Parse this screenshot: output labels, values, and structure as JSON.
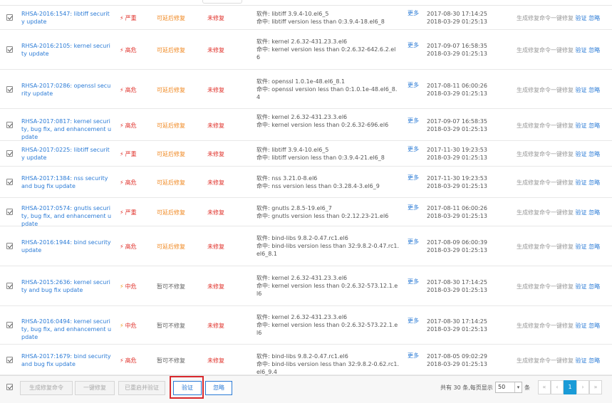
{
  "rows": [
    {
      "name": "RHSA-2016:1547: libtiff security update",
      "level": "严重",
      "level_class": "c-severe",
      "urgency": "可延后修复",
      "urgency_class": "delay",
      "status": "未修复",
      "software": "软件: libtiff 3.9.4-10.el6_5",
      "hit": "命中: libtiff version less than 0:3.9.4-18.el6_8",
      "more": "更多",
      "time1": "2017-08-30 17:14:25",
      "time2": "2018-03-29 01:25:13",
      "gen": "生成修复命令",
      "fix": "一键修复",
      "verify": "验证",
      "ignore": "忽略"
    },
    {
      "name": "RHSA-2016:2105: kernel security update",
      "level": "高危",
      "level_class": "c-high",
      "urgency": "可延后修复",
      "urgency_class": "delay",
      "status": "未修复",
      "software": "软件: kernel 2.6.32-431.23.3.el6",
      "hit": "命中: kernel version less than 0:2.6.32-642.6.2.el6",
      "more": "更多",
      "time1": "2017-09-07 16:58:35",
      "time2": "2018-03-29 01:25:13",
      "gen": "生成修复命令",
      "fix": "一键修复",
      "verify": "验证",
      "ignore": "忽略"
    },
    {
      "name": "RHSA-2017:0286: openssl security update",
      "level": "高危",
      "level_class": "c-high",
      "urgency": "可延后修复",
      "urgency_class": "delay",
      "status": "未修复",
      "software": "软件: openssl 1.0.1e-48.el6_8.1",
      "hit": "命中: openssl version less than 0:1.0.1e-48.el6_8.4",
      "more": "更多",
      "time1": "2017-08-11 06:00:26",
      "time2": "2018-03-29 01:25:13",
      "gen": "生成修复命令",
      "fix": "一键修复",
      "verify": "验证",
      "ignore": "忽略"
    },
    {
      "name": "RHSA-2017:0817: kernel security, bug fix, and enhancement update",
      "level": "高危",
      "level_class": "c-high",
      "urgency": "可延后修复",
      "urgency_class": "delay",
      "status": "未修复",
      "software": "软件: kernel 2.6.32-431.23.3.el6",
      "hit": "命中: kernel version less than 0:2.6.32-696.el6",
      "more": "更多",
      "time1": "2017-09-07 16:58:35",
      "time2": "2018-03-29 01:25:13",
      "gen": "生成修复命令",
      "fix": "一键修复",
      "verify": "验证",
      "ignore": "忽略"
    },
    {
      "name": "RHSA-2017:0225: libtiff security update",
      "level": "严重",
      "level_class": "c-severe",
      "urgency": "可延后修复",
      "urgency_class": "delay",
      "status": "未修复",
      "software": "软件: libtiff 3.9.4-10.el6_5",
      "hit": "命中: libtiff version less than 0:3.9.4-21.el6_8",
      "more": "更多",
      "time1": "2017-11-30 19:23:53",
      "time2": "2018-03-29 01:25:13",
      "gen": "生成修复命令",
      "fix": "一键修复",
      "verify": "验证",
      "ignore": "忽略"
    },
    {
      "name": "RHSA-2017:1384: nss security and bug fix update",
      "level": "高危",
      "level_class": "c-high",
      "urgency": "可延后修复",
      "urgency_class": "delay",
      "status": "未修复",
      "software": "软件: nss 3.21.0-8.el6",
      "hit": "命中: nss version less than 0:3.28.4-3.el6_9",
      "more": "更多",
      "time1": "2017-11-30 19:23:53",
      "time2": "2018-03-29 01:25:13",
      "gen": "生成修复命令",
      "fix": "一键修复",
      "verify": "验证",
      "ignore": "忽略"
    },
    {
      "name": "RHSA-2017:0574: gnutls security, bug fix, and enhancement update",
      "level": "严重",
      "level_class": "c-severe",
      "urgency": "可延后修复",
      "urgency_class": "delay",
      "status": "未修复",
      "software": "软件: gnutls 2.8.5-19.el6_7",
      "hit": "命中: gnutls version less than 0:2.12.23-21.el6",
      "more": "更多",
      "time1": "2017-08-11 06:00:26",
      "time2": "2018-03-29 01:25:13",
      "gen": "生成修复命令",
      "fix": "一键修复",
      "verify": "验证",
      "ignore": "忽略"
    },
    {
      "name": "RHSA-2016:1944: bind security update",
      "level": "高危",
      "level_class": "c-high",
      "urgency": "可延后修复",
      "urgency_class": "delay",
      "status": "未修复",
      "software": "软件: bind-libs 9.8.2-0.47.rc1.el6",
      "hit": "命中: bind-libs version less than 32:9.8.2-0.47.rc1.el6_8.1",
      "more": "更多",
      "time1": "2017-08-09 06:00:39",
      "time2": "2018-03-29 01:25:13",
      "gen": "生成修复命令",
      "fix": "一键修复",
      "verify": "验证",
      "ignore": "忽略"
    },
    {
      "name": "RHSA-2015:2636: kernel security and bug fix update",
      "level": "中危",
      "level_class": "c-mid",
      "urgency": "暂可不修复",
      "urgency_class": "hold",
      "status": "未修复",
      "software": "软件: kernel 2.6.32-431.23.3.el6",
      "hit": "命中: kernel version less than 0:2.6.32-573.12.1.el6",
      "more": "更多",
      "time1": "2017-08-30 17:14:25",
      "time2": "2018-03-29 01:25:13",
      "gen": "生成修复命令",
      "fix": "一键修复",
      "verify": "验证",
      "ignore": "忽略"
    },
    {
      "name": "RHSA-2016:0494: kernel security, bug fix, and enhancement update",
      "level": "中危",
      "level_class": "c-mid",
      "urgency": "暂可不修复",
      "urgency_class": "hold",
      "status": "未修复",
      "software": "软件: kernel 2.6.32-431.23.3.el6",
      "hit": "命中: kernel version less than 0:2.6.32-573.22.1.el6",
      "more": "更多",
      "time1": "2017-08-30 17:14:25",
      "time2": "2018-03-29 01:25:13",
      "gen": "生成修复命令",
      "fix": "一键修复",
      "verify": "验证",
      "ignore": "忽略"
    },
    {
      "name": "RHSA-2017:1679: bind security and bug fix update",
      "level": "高危",
      "level_class": "c-high",
      "urgency": "暂可不修复",
      "urgency_class": "hold",
      "status": "未修复",
      "software": "软件: bind-libs 9.8.2-0.47.rc1.el6",
      "hit": "命中: bind-libs version less than 32:9.8.2-0.62.rc1.el6_9.4",
      "more": "更多",
      "time1": "2017-08-05 09:02:29",
      "time2": "2018-03-29 01:25:13",
      "gen": "生成修复命令",
      "fix": "一键修复",
      "verify": "验证",
      "ignore": "忽略"
    }
  ],
  "footer": {
    "gen_label": "生成修复命令",
    "fix_label": "一键修复",
    "restart_verify_label": "已重启并验证",
    "verify_label": "验证",
    "ignore_label": "忽略",
    "total_text": "共有 30 条,每页显示",
    "page_size": "50",
    "unit": "条",
    "first": "«",
    "prev": "‹",
    "current_page": "1",
    "next": "›",
    "last": "»"
  },
  "colors": {
    "link": "#2b7bd6",
    "danger": "#e0322b",
    "warn": "#f08a24",
    "highlight": "#d9282c",
    "page_active": "#1a9bd7"
  }
}
